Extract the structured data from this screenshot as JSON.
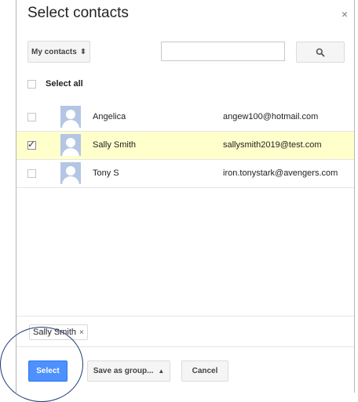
{
  "dialog": {
    "title": "Select contacts",
    "close_glyph": "×"
  },
  "toolbar": {
    "group_select": "My contacts",
    "group_select_icon": "up-down-caret",
    "search_value": "",
    "search_icon": "search-icon"
  },
  "select_all": {
    "label": "Select all",
    "checked": false
  },
  "contacts": [
    {
      "name": "Angelica",
      "email": "angew100@hotmail.com",
      "checked": false
    },
    {
      "name": "Sally Smith",
      "email": "sallysmith2019@test.com",
      "checked": true
    },
    {
      "name": "Tony S",
      "email": "iron.tonystark@avengers.com",
      "checked": false
    }
  ],
  "selected_chips": [
    {
      "label": "Sally Smith",
      "remove_glyph": "×"
    }
  ],
  "footer": {
    "select_label": "Select",
    "save_group_label": "Save as group...",
    "save_group_caret": "▲",
    "cancel_label": "Cancel"
  },
  "colors": {
    "selected_row": "#ffffcc",
    "primary_button": "#4d90fe",
    "avatar": "#b4c6e4",
    "annotation": "#1f3a78"
  }
}
